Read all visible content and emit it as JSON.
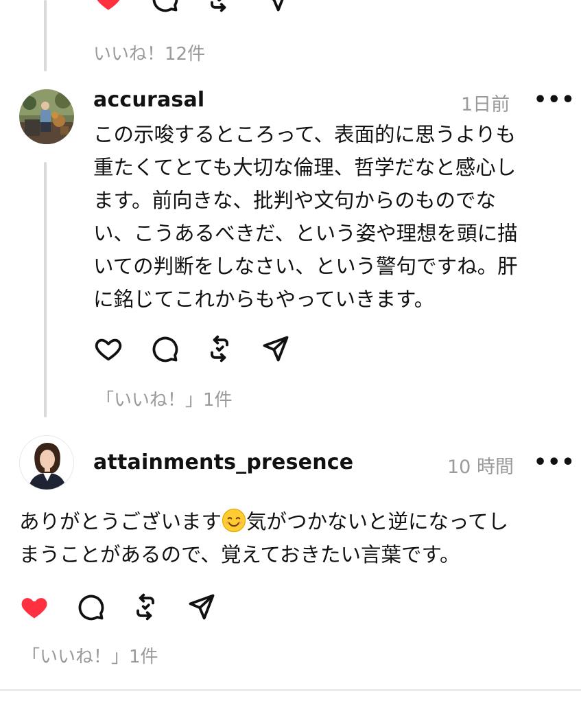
{
  "colors": {
    "liked": "#ff3040",
    "muted": "#9a9a9a",
    "text": "#111111"
  },
  "previous_post": {
    "likes_text": "いいね！12件",
    "actions": {
      "like": "heart-filled-icon",
      "comment": "comment-icon",
      "repost": "repost-icon",
      "share": "send-icon"
    },
    "liked": true
  },
  "comment1": {
    "username": "accurasal",
    "time": "1日前",
    "more_label": "•••",
    "lines": [
      "この示唆するところって、表面的に思うよりも",
      "重たくてとても大切な倫理、哲学だなと感心し",
      "ます。前向きな、批判や文句からのものでな",
      "い、こうあるべきだ、という姿や理想を頭に描",
      "いての判断をしなさい、という警句ですね。肝",
      "に銘じてこれからもやっていきます。"
    ],
    "actions": {
      "like": "heart-outline-icon",
      "comment": "comment-icon",
      "repost": "repost-icon",
      "share": "send-icon"
    },
    "liked": false,
    "likes_text": "「いいね！」1件"
  },
  "comment2": {
    "username": "attainments_presence",
    "time": "10 時間",
    "more_label": "•••",
    "text_before_emoji": "ありがとうございます",
    "emoji": "smiling-face-icon",
    "text_after_emoji": "気がつかないと逆になってし",
    "line2": "まうことがあるので、覚えておきたい言葉です。",
    "actions": {
      "like": "heart-filled-icon",
      "comment": "comment-icon",
      "repost": "repost-icon",
      "share": "send-icon"
    },
    "liked": true,
    "likes_text": "「いいね！」1件"
  }
}
